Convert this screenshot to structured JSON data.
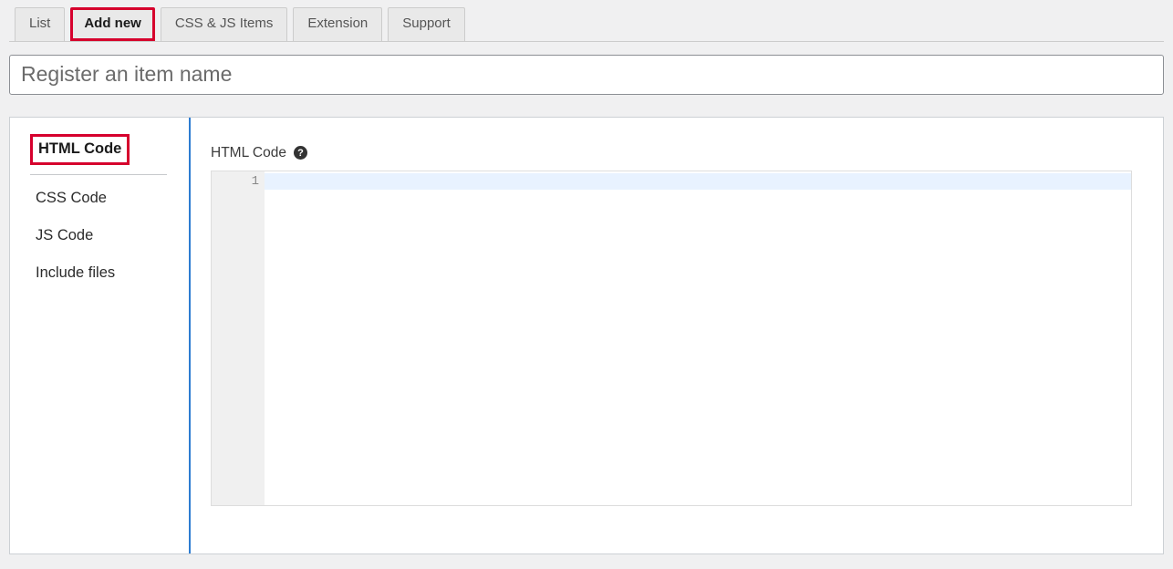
{
  "tabs": {
    "list": "List",
    "add_new": "Add new",
    "css_js_items": "CSS & JS Items",
    "extension": "Extension",
    "support": "Support"
  },
  "item_name_placeholder": "Register an item name",
  "item_name_value": "",
  "side_tabs": {
    "html": "HTML Code",
    "css": "CSS Code",
    "js": "JS Code",
    "include": "Include files"
  },
  "editor": {
    "label": "HTML Code",
    "help_tooltip": "?",
    "line_numbers": [
      "1"
    ],
    "content": ""
  }
}
